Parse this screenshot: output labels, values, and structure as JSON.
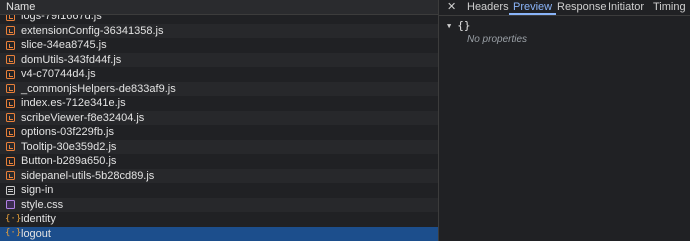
{
  "network": {
    "column_header": "Name",
    "rows": [
      {
        "name": "logs-79f1667d.js",
        "type": "js"
      },
      {
        "name": "extensionConfig-36341358.js",
        "type": "js"
      },
      {
        "name": "slice-34ea8745.js",
        "type": "js"
      },
      {
        "name": "domUtils-343fd44f.js",
        "type": "js"
      },
      {
        "name": "v4-c70744d4.js",
        "type": "js"
      },
      {
        "name": "_commonjsHelpers-de833af9.js",
        "type": "js"
      },
      {
        "name": "index.es-712e341e.js",
        "type": "js"
      },
      {
        "name": "scribeViewer-f8e32404.js",
        "type": "js"
      },
      {
        "name": "options-03f229fb.js",
        "type": "js"
      },
      {
        "name": "Tooltip-30e359d2.js",
        "type": "js"
      },
      {
        "name": "Button-b289a650.js",
        "type": "js"
      },
      {
        "name": "sidepanel-utils-5b28cd89.js",
        "type": "js"
      },
      {
        "name": "sign-in",
        "type": "doc"
      },
      {
        "name": "style.css",
        "type": "css"
      },
      {
        "name": "identity",
        "type": "xhr"
      },
      {
        "name": "logout",
        "type": "xhr",
        "selected": true
      }
    ]
  },
  "detail": {
    "close_label": "✕",
    "tabs": [
      "Headers",
      "Preview",
      "Response",
      "Initiator",
      "Timing"
    ],
    "active_tab": "Preview",
    "preview": {
      "root_label": "{}",
      "empty_text": "No properties"
    }
  },
  "colors": {
    "selected_row": "#1c4e8c",
    "active_tab": "#8ab4f8",
    "js_icon": "#e8803a",
    "css_icon": "#b281e6",
    "xhr_icon": "#e8a03a"
  },
  "icons": {
    "js": "script-file-icon",
    "doc": "document-icon",
    "css": "stylesheet-icon",
    "xhr": "fetch-xhr-icon"
  }
}
